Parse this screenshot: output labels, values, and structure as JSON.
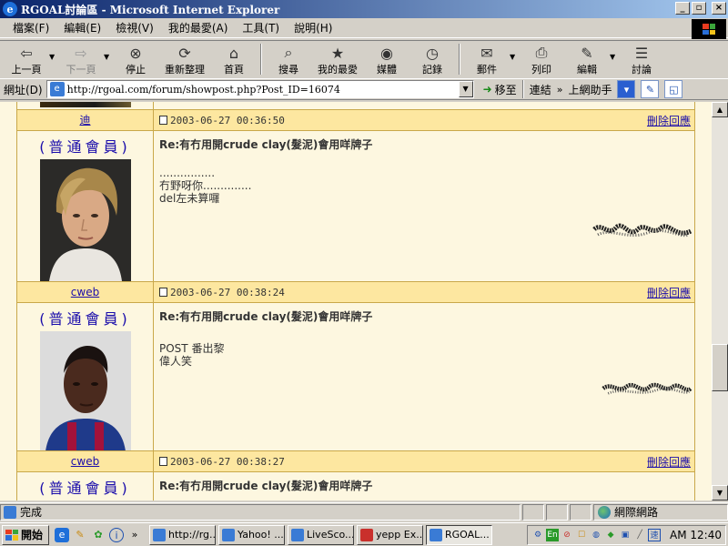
{
  "window": {
    "title": "RGOAL討論區 - Microsoft Internet Explorer",
    "controls": [
      "_",
      "▫",
      "×"
    ]
  },
  "menu": [
    "檔案(F)",
    "編輯(E)",
    "檢視(V)",
    "我的最愛(A)",
    "工具(T)",
    "說明(H)"
  ],
  "toolbar": {
    "back": "上一頁",
    "forward": "下一頁",
    "stop": "停止",
    "refresh": "重新整理",
    "home": "首頁",
    "search": "搜尋",
    "favorites": "我的最愛",
    "media": "媒體",
    "history": "記錄",
    "mail": "郵件",
    "print": "列印",
    "edit": "編輯",
    "discuss": "討論"
  },
  "address": {
    "label": "網址(D)",
    "url": "http://rgoal.com/forum/showpost.php?Post_ID=16074",
    "go": "移至",
    "links": "連結",
    "helper": "上網助手"
  },
  "forum": {
    "first_head": {
      "name": "迪",
      "date": "2003-06-27 00:36:50",
      "delete": "刪除回應"
    },
    "posts": [
      {
        "rank": "(普通會員)",
        "subject": "Re:有冇用開crude clay(髮泥)會用咩牌子",
        "lines": [
          "................",
          "冇野呀你..............",
          "del左未算囉"
        ],
        "author": "cweb",
        "date": "2003-06-27 00:38:24",
        "delete": "刪除回應"
      },
      {
        "rank": "(普通會員)",
        "subject": "Re:有冇用開crude clay(髮泥)會用咩牌子",
        "lines": [
          "POST 番出黎",
          "偉人笑"
        ],
        "author": "cweb",
        "date": "2003-06-27 00:38:27",
        "delete": "刪除回應"
      },
      {
        "rank": "(普通會員)",
        "subject": "Re:有冇用開crude clay(髮泥)會用咩牌子",
        "lines": []
      }
    ]
  },
  "status": {
    "text": "完成",
    "zone": "網際網路"
  },
  "taskbar": {
    "start": "開始",
    "tasks": [
      "http://rg...",
      "Yahoo! ...",
      "LiveSco...",
      "yepp Ex...",
      "RGOAL..."
    ],
    "tray_lang": "En",
    "clock": "AM 12:40"
  },
  "colors": {
    "title_start": "#0a246a",
    "title_end": "#a6caf0",
    "forum_border": "#c9a84a",
    "forum_head": "#fde7a0",
    "forum_body": "#fdf7e0",
    "link": "#1a0dab"
  }
}
